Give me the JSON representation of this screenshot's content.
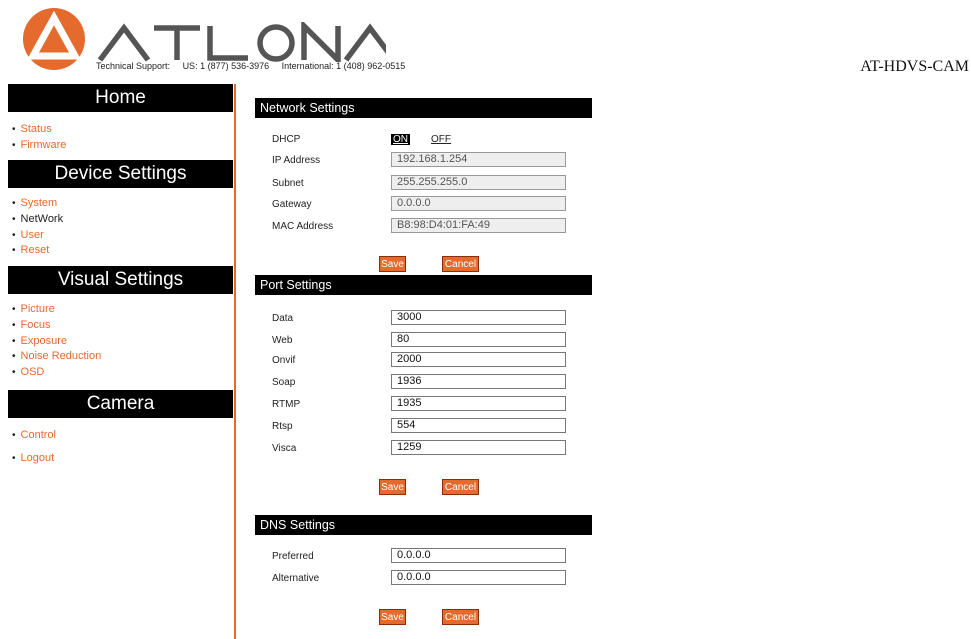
{
  "header": {
    "brand": "ATLONA",
    "support_label": "Technical Support:",
    "support_us": "US: 1 (877) 536-3976",
    "support_intl": "International: 1 (408) 962-0515",
    "model": "AT-HDVS-CAM"
  },
  "sidebar": {
    "home": {
      "title": "Home",
      "items": [
        "Status",
        "Firmware"
      ]
    },
    "device": {
      "title": "Device Settings",
      "items": [
        "System",
        "NetWork",
        "User",
        "Reset"
      ]
    },
    "visual": {
      "title": "Visual Settings",
      "items": [
        "Picture",
        "Focus",
        "Exposure",
        "Noise Reduction",
        "OSD"
      ]
    },
    "camera": {
      "title": "Camera",
      "items": [
        "Control"
      ]
    },
    "logout": "Logout"
  },
  "network": {
    "title": "Network Settings",
    "dhcp_label": "DHCP",
    "dhcp_on": "ON",
    "dhcp_off": "OFF",
    "ip_label": "IP Address",
    "ip": "192.168.1.254",
    "subnet_label": "Subnet",
    "subnet": "255.255.255.0",
    "gateway_label": "Gateway",
    "gateway": "0.0.0.0",
    "mac_label": "MAC Address",
    "mac": "B8:98:D4:01:FA:49",
    "save": "Save",
    "cancel": "Cancel"
  },
  "ports": {
    "title": "Port Settings",
    "data_label": "Data",
    "data": "3000",
    "web_label": "Web",
    "web": "80",
    "onvif_label": "Onvif",
    "onvif": "2000",
    "soap_label": "Soap",
    "soap": "1936",
    "rtmp_label": "RTMP",
    "rtmp": "1935",
    "rtsp_label": "Rtsp",
    "rtsp": "554",
    "visca_label": "Visca",
    "visca": "1259",
    "save": "Save",
    "cancel": "Cancel"
  },
  "dns": {
    "title": "DNS Settings",
    "preferred_label": "Preferred",
    "preferred": "0.0.0.0",
    "alternative_label": "Alternative",
    "alternative": "0.0.0.0",
    "save": "Save",
    "cancel": "Cancel"
  },
  "colors": {
    "accent": "#e56a2e",
    "header_bg": "#000000"
  }
}
